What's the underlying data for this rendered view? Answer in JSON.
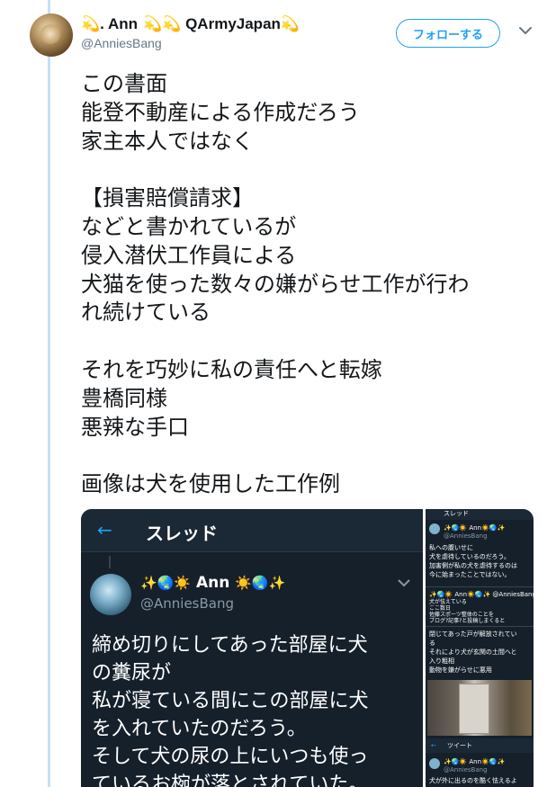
{
  "author": {
    "display_name_prefix": "💫. Ann",
    "display_name_suffix": "💫💫 QArmyJapan💫",
    "handle": "@AnniesBang"
  },
  "actions": {
    "follow_label": "フォローする",
    "caret_icon": "chevron-down-icon"
  },
  "tweet": {
    "lines": [
      "この書面",
      "能登不動産による作成だろう",
      "家主本人ではなく",
      "",
      "【損害賠償請求】",
      "などと書かれているが",
      "侵入潜伏工作員による",
      "犬猫を使った数々の嫌がらせ工作が行わ",
      "れ続けている",
      "",
      "それを巧妙に私の責任へと転嫁",
      "豊橋同様",
      "悪辣な手口",
      "",
      "画像は犬を使用した工作例"
    ]
  },
  "media": {
    "main": {
      "back_icon": "←",
      "title": "スレッド",
      "name_icons": "✨🌏☀️",
      "name": "Ann",
      "name_icons_after": "☀️🌏✨",
      "handle": "@AnniesBang",
      "text_lines": [
        "締め切りにしてあった部屋に犬",
        "の糞尿が",
        "私が寝ている間にこの部屋に犬",
        "を入れていたのだろう。",
        "そして犬の尿の上にいつも使っ",
        "ているお椀が落とされていた。"
      ]
    },
    "side": {
      "top_title": "スレッド",
      "name1": "✨🌏☀️ Ann☀️🌏✨",
      "handle1": "@AnniesBang",
      "text1": [
        "私への腹いせに",
        "犬を虐待しているのだろう。",
        "加害側が私の犬を虐待するのは",
        "今に始まったことではない。"
      ],
      "name2": "✨🌏☀️ Ann☀️🌏✨ @AnniesBang",
      "text2": [
        "犬が怯えている",
        "ここ数日",
        "佐藤スポーツ整体のことを",
        "ブログ?記事?と投稿しまくると"
      ],
      "text3": [
        "閉じてあった戸が解放されてい",
        "る",
        "それにより犬が玄関の土間へと",
        "入り粗相",
        "動物を嫌がらせに悪用"
      ],
      "tweet_bar": "ツイート",
      "name3": "✨🌏☀️ Ann☀️🌏✨",
      "handle3": "@AnniesBang",
      "text4": [
        "犬が外に出るのを酷く怯えるよ"
      ]
    }
  },
  "colors": {
    "accent": "#1da1f2",
    "thread_line": "#c4e0f6",
    "dark_bg": "#15202b"
  }
}
